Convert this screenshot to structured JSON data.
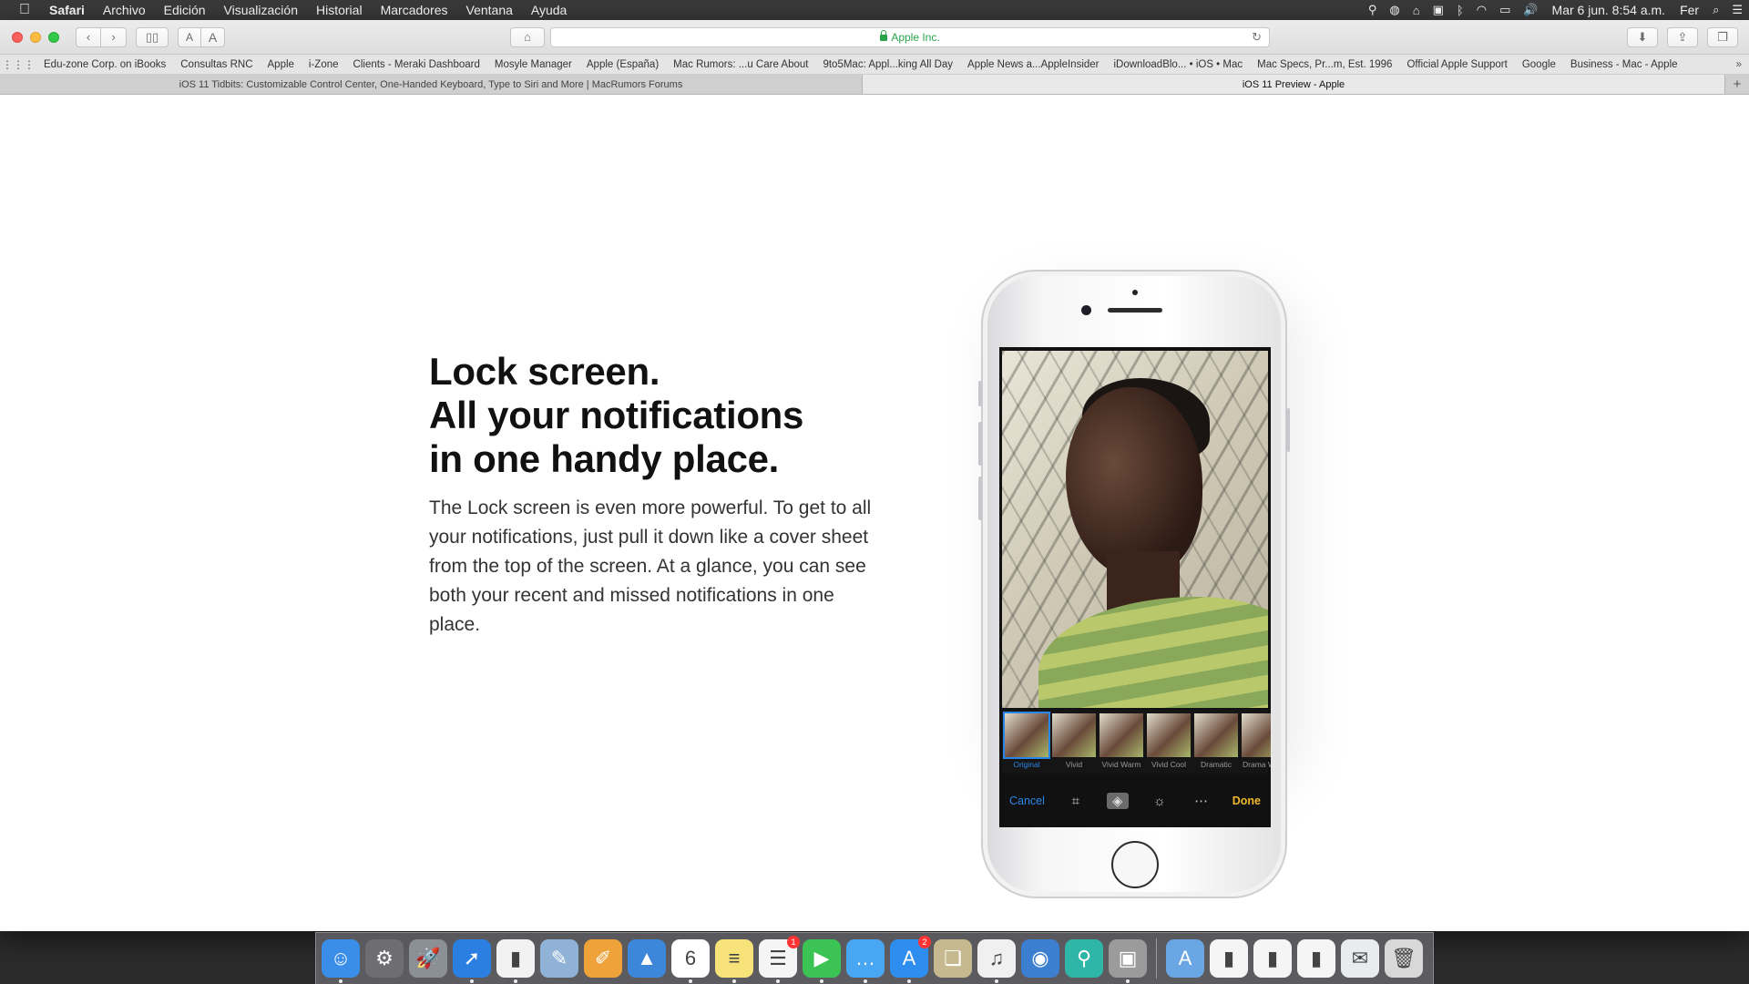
{
  "menubar": {
    "app_name": "Safari",
    "menus": [
      "Archivo",
      "Edición",
      "Visualización",
      "Historial",
      "Marcadores",
      "Ventana",
      "Ayuda"
    ],
    "datetime": "Mar 6 jun.  8:54 a.m.",
    "user": "Fer"
  },
  "toolbar": {
    "url_text": "Apple Inc.",
    "font_small": "A",
    "font_large": "A"
  },
  "bookmarks": [
    "Edu-zone Corp. on iBooks",
    "Consultas RNC",
    "Apple",
    "i-Zone",
    "Clients - Meraki Dashboard",
    "Mosyle Manager",
    "Apple (España)",
    "Mac Rumors: ...u Care About",
    "9to5Mac: Appl...king All Day",
    "Apple News a...AppleInsider",
    "iDownloadBlo... • iOS • Mac",
    "Mac Specs, Pr...m, Est. 1996",
    "Official Apple Support",
    "Google",
    "Business - Mac - Apple"
  ],
  "tabs": [
    {
      "title": "iOS 11 Tidbits: Customizable Control Center, One-Handed Keyboard, Type to Siri and More | MacRumors Forums"
    },
    {
      "title": "iOS 11 Preview - Apple"
    }
  ],
  "page": {
    "headline_lines": [
      "Lock screen.",
      "All your notifications",
      "in one handy place."
    ],
    "body": "The Lock screen is even more powerful. To get to all your notifications, just pull it down like a cover sheet from the top of the screen. At a glance, you can see both your recent and missed notifications in one place."
  },
  "phone": {
    "filters": [
      "Original",
      "Vivid",
      "Vivid Warm",
      "Vivid Cool",
      "Dramatic",
      "Drama Warr"
    ],
    "cancel": "Cancel",
    "done": "Done"
  },
  "dock": {
    "icons": [
      {
        "name": "finder-icon",
        "color": "#3b8ee8",
        "glyph": "☺",
        "running": true
      },
      {
        "name": "system-preferences-icon",
        "color": "#6d6d72",
        "glyph": "⚙",
        "running": false
      },
      {
        "name": "launchpad-icon",
        "color": "#8b8f96",
        "glyph": "🚀",
        "running": false
      },
      {
        "name": "safari-icon",
        "color": "#2a7fe0",
        "glyph": "➚",
        "running": true
      },
      {
        "name": "numbers-icon",
        "color": "#f2f2f2",
        "glyph": "▮",
        "running": true
      },
      {
        "name": "preview-icon",
        "color": "#8fb2d6",
        "glyph": "✎",
        "running": false
      },
      {
        "name": "pages-icon",
        "color": "#f0a23a",
        "glyph": "✐",
        "running": false
      },
      {
        "name": "keynote-icon",
        "color": "#3c87d9",
        "glyph": "▲",
        "running": false
      },
      {
        "name": "calendar-icon",
        "color": "#ffffff",
        "glyph": "6",
        "running": true
      },
      {
        "name": "notes-icon",
        "color": "#f7e37a",
        "glyph": "≡",
        "running": true
      },
      {
        "name": "reminders-icon",
        "color": "#f5f5f5",
        "glyph": "☰",
        "badge": "1",
        "running": true
      },
      {
        "name": "facetime-icon",
        "color": "#3bc454",
        "glyph": "▶",
        "running": true
      },
      {
        "name": "messages-icon",
        "color": "#49a6f2",
        "glyph": "…",
        "running": true
      },
      {
        "name": "app-store-icon",
        "color": "#2d8ef0",
        "glyph": "A",
        "badge": "2",
        "running": true
      },
      {
        "name": "photos-preview-icon",
        "color": "#c7b98f",
        "glyph": "❏",
        "running": false
      },
      {
        "name": "itunes-icon",
        "color": "#f0f0f0",
        "glyph": "♫",
        "running": true
      },
      {
        "name": "tweetbot-icon",
        "color": "#3c7fd0",
        "glyph": "◉",
        "running": false
      },
      {
        "name": "maps-pin-icon",
        "color": "#2fb6a9",
        "glyph": "⚲",
        "running": false
      },
      {
        "name": "image-capture-icon",
        "color": "#9b9b9b",
        "glyph": "▣",
        "running": true
      }
    ],
    "right_icons": [
      {
        "name": "applications-folder-icon",
        "color": "#6aa6e4",
        "glyph": "A"
      },
      {
        "name": "numbers-document-icon",
        "color": "#f5f5f5",
        "glyph": "▮"
      },
      {
        "name": "numbers-document-2-icon",
        "color": "#f5f5f5",
        "glyph": "▮"
      },
      {
        "name": "numbers-document-3-icon",
        "color": "#f5f5f5",
        "glyph": "▮"
      },
      {
        "name": "mail-document-icon",
        "color": "#e9ecef",
        "glyph": "✉"
      },
      {
        "name": "trash-icon",
        "color": "#d8d8d8",
        "glyph": "🗑"
      }
    ]
  }
}
